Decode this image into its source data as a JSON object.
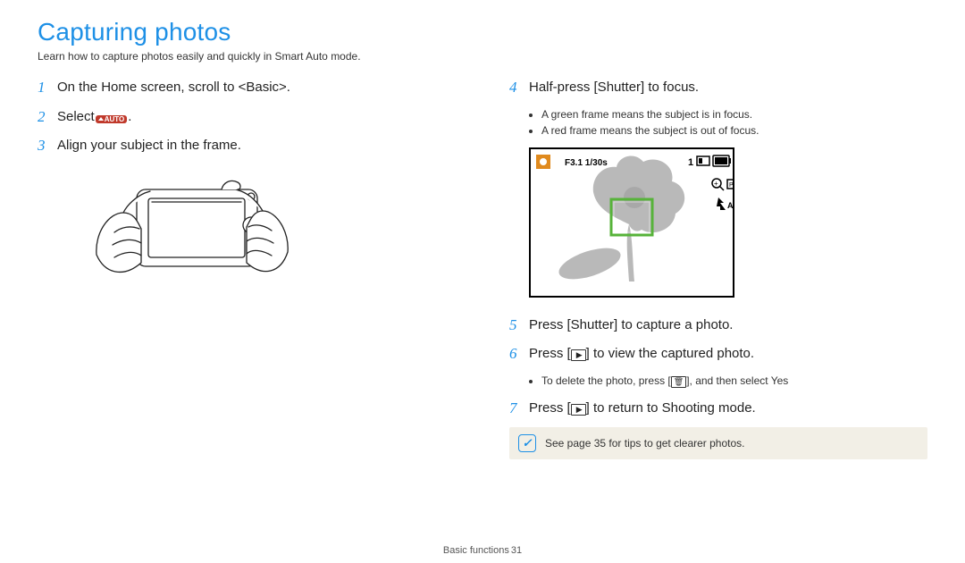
{
  "title": "Capturing photos",
  "subtitle": "Learn how to capture photos easily and quickly in Smart Auto mode.",
  "left": {
    "s1": {
      "n": "1",
      "t": "On the Home screen, scroll to <Basic>."
    },
    "s2": {
      "n": "2",
      "t_a": "Select",
      "icon_label": "AUTO",
      "t_b": "."
    },
    "s3": {
      "n": "3",
      "t": "Align your subject in the frame."
    }
  },
  "right": {
    "s4": {
      "n": "4",
      "t": "Half-press [Shutter] to focus.",
      "b1": "A green frame means the subject is in focus.",
      "b2": "A red frame means the subject is out of focus."
    },
    "lcd": {
      "exposure": "F3.1 1/30s",
      "count": "1"
    },
    "s5": {
      "n": "5",
      "t": "Press [Shutter] to capture a photo."
    },
    "s6": {
      "n": "6",
      "t_a": "Press [",
      "t_b": "] to view the captured photo.",
      "b1_a": "To delete the photo, press [",
      "b1_b": "], and then select Yes"
    },
    "s7": {
      "n": "7",
      "t_a": "Press [",
      "t_b": "] to return to Shooting mode."
    }
  },
  "note": "See page 35 for tips to get clearer photos.",
  "footer": {
    "section": "Basic functions",
    "page": "31"
  }
}
